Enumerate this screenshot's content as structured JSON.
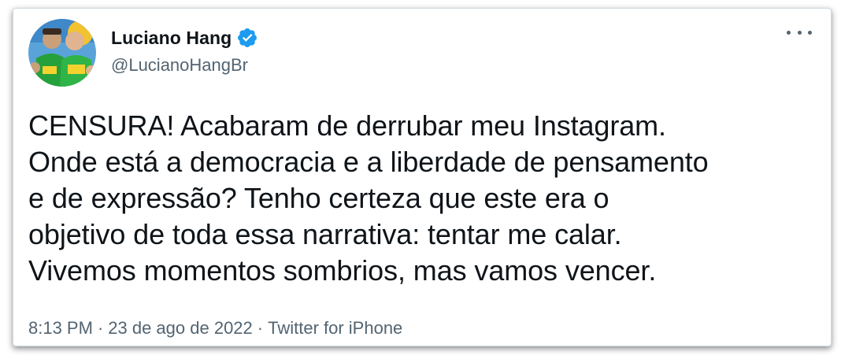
{
  "tweet": {
    "author": {
      "display_name": "Luciano Hang",
      "handle": "@LucianoHangBr",
      "verified": true,
      "avatar_icon": "profile-photo"
    },
    "more_icon": "more-options-icon",
    "text": "CENSURA! Acabaram de derrubar meu Instagram.\nOnde está a democracia e a liberdade de pensamento\ne de expressão? Tenho certeza que este era o\nobjetivo de toda essa narrativa: tentar me calar.\nVivemos momentos sombrios, mas vamos vencer.",
    "time": "8:13 PM",
    "separator": "·",
    "date": "23 de ago de 2022",
    "source": "Twitter for iPhone"
  },
  "colors": {
    "text_primary": "#0f1419",
    "text_secondary": "#536471",
    "verified_blue": "#1d9bf0",
    "border": "#cfd9de"
  }
}
